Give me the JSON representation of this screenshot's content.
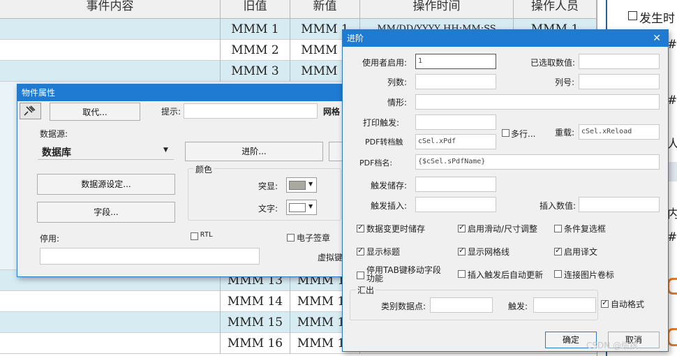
{
  "grid": {
    "headers": [
      "事件内容",
      "旧值",
      "新值",
      "操作时间",
      "操作人员"
    ],
    "rows": [
      {
        "old": "MMM 1",
        "new": "MMM 1",
        "time": "MM/DD/YYYY HH:MM:SS",
        "user": "MMM 1"
      },
      {
        "old": "MMM 2",
        "new": "MMM 2",
        "time": "",
        "user": ""
      },
      {
        "old": "MMM 3",
        "new": "MMM 3",
        "time": "",
        "user": ""
      },
      {
        "old": "MMM 13",
        "new": "MMM 13",
        "time": "",
        "user": ""
      },
      {
        "old": "MMM 14",
        "new": "MMM 14",
        "time": "",
        "user": ""
      },
      {
        "old": "MMM 15",
        "new": "MMM 15",
        "time": "",
        "user": ""
      },
      {
        "old": "MMM 16",
        "new": "MMM 16",
        "time": "",
        "user": ""
      }
    ]
  },
  "right_panel": {
    "checkbox_label": "发生时",
    "fragments": [
      "#",
      "#",
      "人",
      "内",
      "#"
    ]
  },
  "props": {
    "title": "物件属性",
    "replace_label": "取代...",
    "hint_label": "提示:",
    "hint_value": "",
    "grid_label": "网格",
    "datasource_label": "数据源:",
    "datasource_value": "数据库",
    "advanced_label": "进阶...",
    "color_group": "颜色",
    "highlight_label": "突显:",
    "text_label": "文字:",
    "highlight_color": "#a9a9a2",
    "text_color": "#ffffff",
    "datasource_setup_label": "数据源设定...",
    "fields_label": "字段...",
    "disable_label": "停用:",
    "rtl_label": "RTL",
    "esign_label": "电子签章",
    "virtual_key_label": "虚拟键"
  },
  "adv": {
    "title": "进阶",
    "user_enable_label": "使用者启用:",
    "user_enable_value": "1",
    "selected_value_label": "已选取数值:",
    "selected_value": "",
    "columns_label": "列数:",
    "col_no_label": "列号:",
    "situation_label": "情形:",
    "print_trigger_label": "打印触发:",
    "pdf_convert_label": "PDF转档触",
    "pdf_convert_value": "cSel.xPdf",
    "multi_label": "多行...",
    "reload_label": "重载:",
    "reload_value": "cSel.xReload",
    "pdf_name_label": "PDF档名:",
    "pdf_name_value": "{$cSel.sPdfName}",
    "trigger_save_label": "触发储存:",
    "trigger_insert_label": "触发插入:",
    "insert_value_label": "插入数值:",
    "checks": [
      {
        "label": "数据变更时储存",
        "checked": true
      },
      {
        "label": "启用滑动/尺寸调整",
        "checked": true
      },
      {
        "label": "条件复选框",
        "checked": false
      },
      {
        "label": "显示标题",
        "checked": true
      },
      {
        "label": "显示网格线",
        "checked": true
      },
      {
        "label": "启用译文",
        "checked": true
      },
      {
        "label": "停用TAB键移动字段功能",
        "checked": false
      },
      {
        "label": "插入触发后自动更新",
        "checked": false
      },
      {
        "label": "连接图片卷标",
        "checked": false
      }
    ],
    "export_group": "汇出",
    "category_label": "类别数据点:",
    "trigger_label": "触发:",
    "auto_format_label": "自动格式",
    "ok_label": "确定",
    "cancel_label": "取消"
  },
  "watermark": "CSDN @缆孩"
}
